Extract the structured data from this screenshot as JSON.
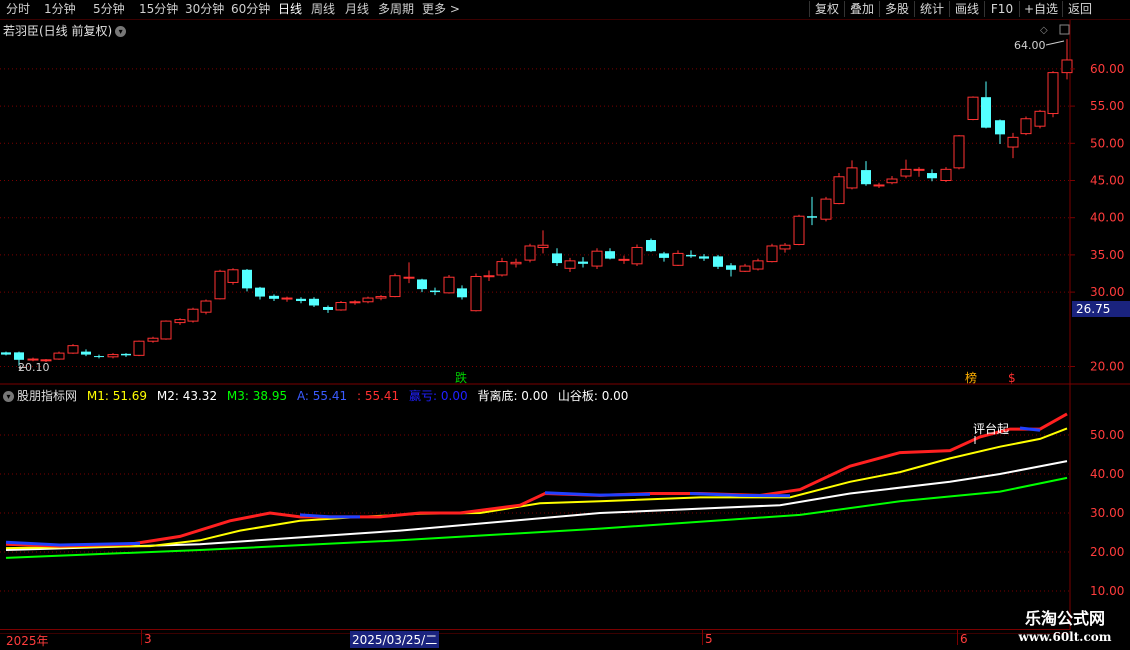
{
  "toolbar": {
    "periods": [
      "分时",
      "1分钟",
      "5分钟",
      "15分钟",
      "30分钟",
      "60分钟",
      "日线",
      "周线",
      "月线",
      "多周期",
      "更多 >"
    ],
    "active_period": "日线",
    "buttons": [
      "复权",
      "叠加",
      "多股",
      "统计",
      "画线",
      "F10",
      "+自选",
      "返回"
    ]
  },
  "main_chart": {
    "title": "若羽臣(日线 前复权)",
    "price_labels": [
      "60.00",
      "55.00",
      "50.00",
      "45.00",
      "40.00",
      "35.00",
      "30.00",
      "20.00"
    ],
    "current_price_tag": "26.75",
    "high_label": "64.00",
    "low_label": "20.10",
    "markers": [
      "跌",
      "榜",
      "$"
    ],
    "colors": {
      "up": "#ff3232",
      "down": "#54ffff",
      "grid": "#7a0000",
      "axis_text": "#ff3c3c"
    }
  },
  "indicator": {
    "name": "股朋指标网",
    "fields": [
      {
        "label": "M1: 51.69",
        "color": "#ffff00"
      },
      {
        "label": "M2: 43.32",
        "color": "#ffffff"
      },
      {
        "label": "M3: 38.95",
        "color": "#00ff00"
      },
      {
        "label": "A: 55.41",
        "color": "#3a5bff"
      },
      {
        "label": ": 55.41",
        "color": "#ff3030"
      },
      {
        "label": "赢亏: 0.00",
        "color": "#2020ff"
      },
      {
        "label": "背离底: 0.00",
        "color": "#ffffff"
      },
      {
        "label": "山谷板: 0.00",
        "color": "#ffffff"
      }
    ],
    "annotation": "评台起",
    "axis_labels": [
      "50.00",
      "40.00",
      "30.00",
      "20.00",
      "10.00"
    ]
  },
  "bottom_axis": {
    "labels": [
      "2025年",
      "3",
      "2025/03/25/二",
      "5",
      "6"
    ]
  },
  "watermark": {
    "line1": "乐淘公式网",
    "line2": "www.60lt.com"
  }
}
